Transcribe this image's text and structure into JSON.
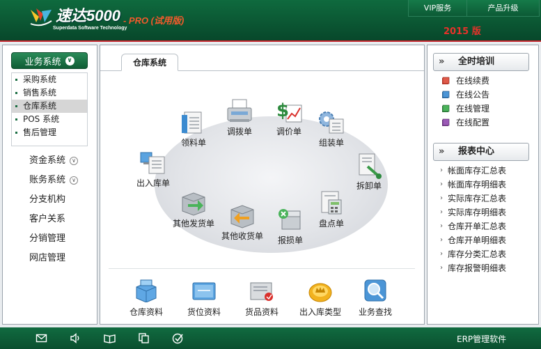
{
  "header": {
    "logo_text": "速达5000",
    "logo_subtitle": "Superdata Software Technology",
    "logo_edition": "- PRO (试用版)",
    "nav": [
      "VIP服务",
      "产品升级"
    ],
    "version": "2015 版"
  },
  "left_nav": {
    "business": {
      "label": "业务系统",
      "items": [
        "采购系统",
        "销售系统",
        "仓库系统",
        "POS 系统",
        "售后管理"
      ],
      "active": "仓库系统"
    },
    "funds": "资金系统",
    "accounts": "账务系统",
    "branch": "分支机构",
    "crm": "客户关系",
    "distribution": "分销管理",
    "online_store": "网店管理"
  },
  "main": {
    "tab": "仓库系统",
    "flow": {
      "requisition": "领料单",
      "transfer": "调拨单",
      "price_adjust": "调价单",
      "assembly": "组装单",
      "in_out": "出入库单",
      "disassembly": "拆卸单",
      "other_issue": "其他发货单",
      "other_receipt": "其他收货单",
      "loss": "报损单",
      "stocktake": "盘点单"
    },
    "tools": {
      "warehouse_info": "仓库资料",
      "location_info": "货位资料",
      "goods_info": "货品资料",
      "io_type": "出入库类型",
      "biz_search": "业务查找"
    }
  },
  "right": {
    "training": {
      "title": "全时培训",
      "items": [
        "在线续费",
        "在线公告",
        "在线管理",
        "在线配置"
      ]
    },
    "reports": {
      "title": "报表中心",
      "items": [
        "帐面库存汇总表",
        "帐面库存明细表",
        "实际库存汇总表",
        "实际库存明细表",
        "仓库开单汇总表",
        "仓库开单明细表",
        "库存分类汇总表",
        "库存报警明细表"
      ]
    }
  },
  "footer": {
    "brand": "ERP管理软件"
  },
  "colors": {
    "header_green": "#0b5733",
    "accent_red": "#c6252c",
    "version_red": "#e8322a"
  }
}
